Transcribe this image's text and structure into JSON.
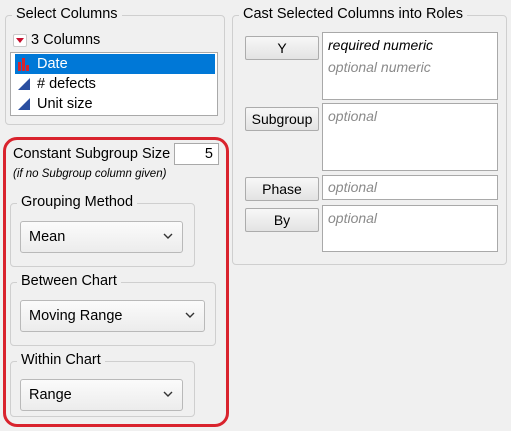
{
  "select_columns": {
    "title": "Select Columns",
    "count_label": "3 Columns",
    "items": [
      {
        "label": "Date",
        "icon": "bar-chart-icon",
        "selected": true
      },
      {
        "label": "# defects",
        "icon": "continuous-triangle-icon",
        "selected": false
      },
      {
        "label": "Unit size",
        "icon": "continuous-triangle-icon",
        "selected": false
      }
    ]
  },
  "options": {
    "constant_subgroup_label": "Constant Subgroup Size",
    "constant_subgroup_value": "5",
    "constant_subgroup_hint": "(if no Subgroup column given)",
    "grouping_method": {
      "title": "Grouping Method",
      "value": "Mean"
    },
    "between_chart": {
      "title": "Between Chart",
      "value": "Moving Range"
    },
    "within_chart": {
      "title": "Within Chart",
      "value": "Range"
    }
  },
  "cast_roles": {
    "title": "Cast Selected Columns into Roles",
    "y": {
      "button": "Y",
      "line1": "required numeric",
      "line2": "optional numeric"
    },
    "subgroup": {
      "button": "Subgroup",
      "hint": "optional"
    },
    "phase": {
      "button": "Phase",
      "hint": "optional"
    },
    "by": {
      "button": "By",
      "hint": "optional"
    }
  },
  "colors": {
    "highlight_outline": "#d9232d",
    "selection": "#0078d7",
    "icon_red": "#c8102e",
    "icon_blue": "#2a4fa0"
  }
}
